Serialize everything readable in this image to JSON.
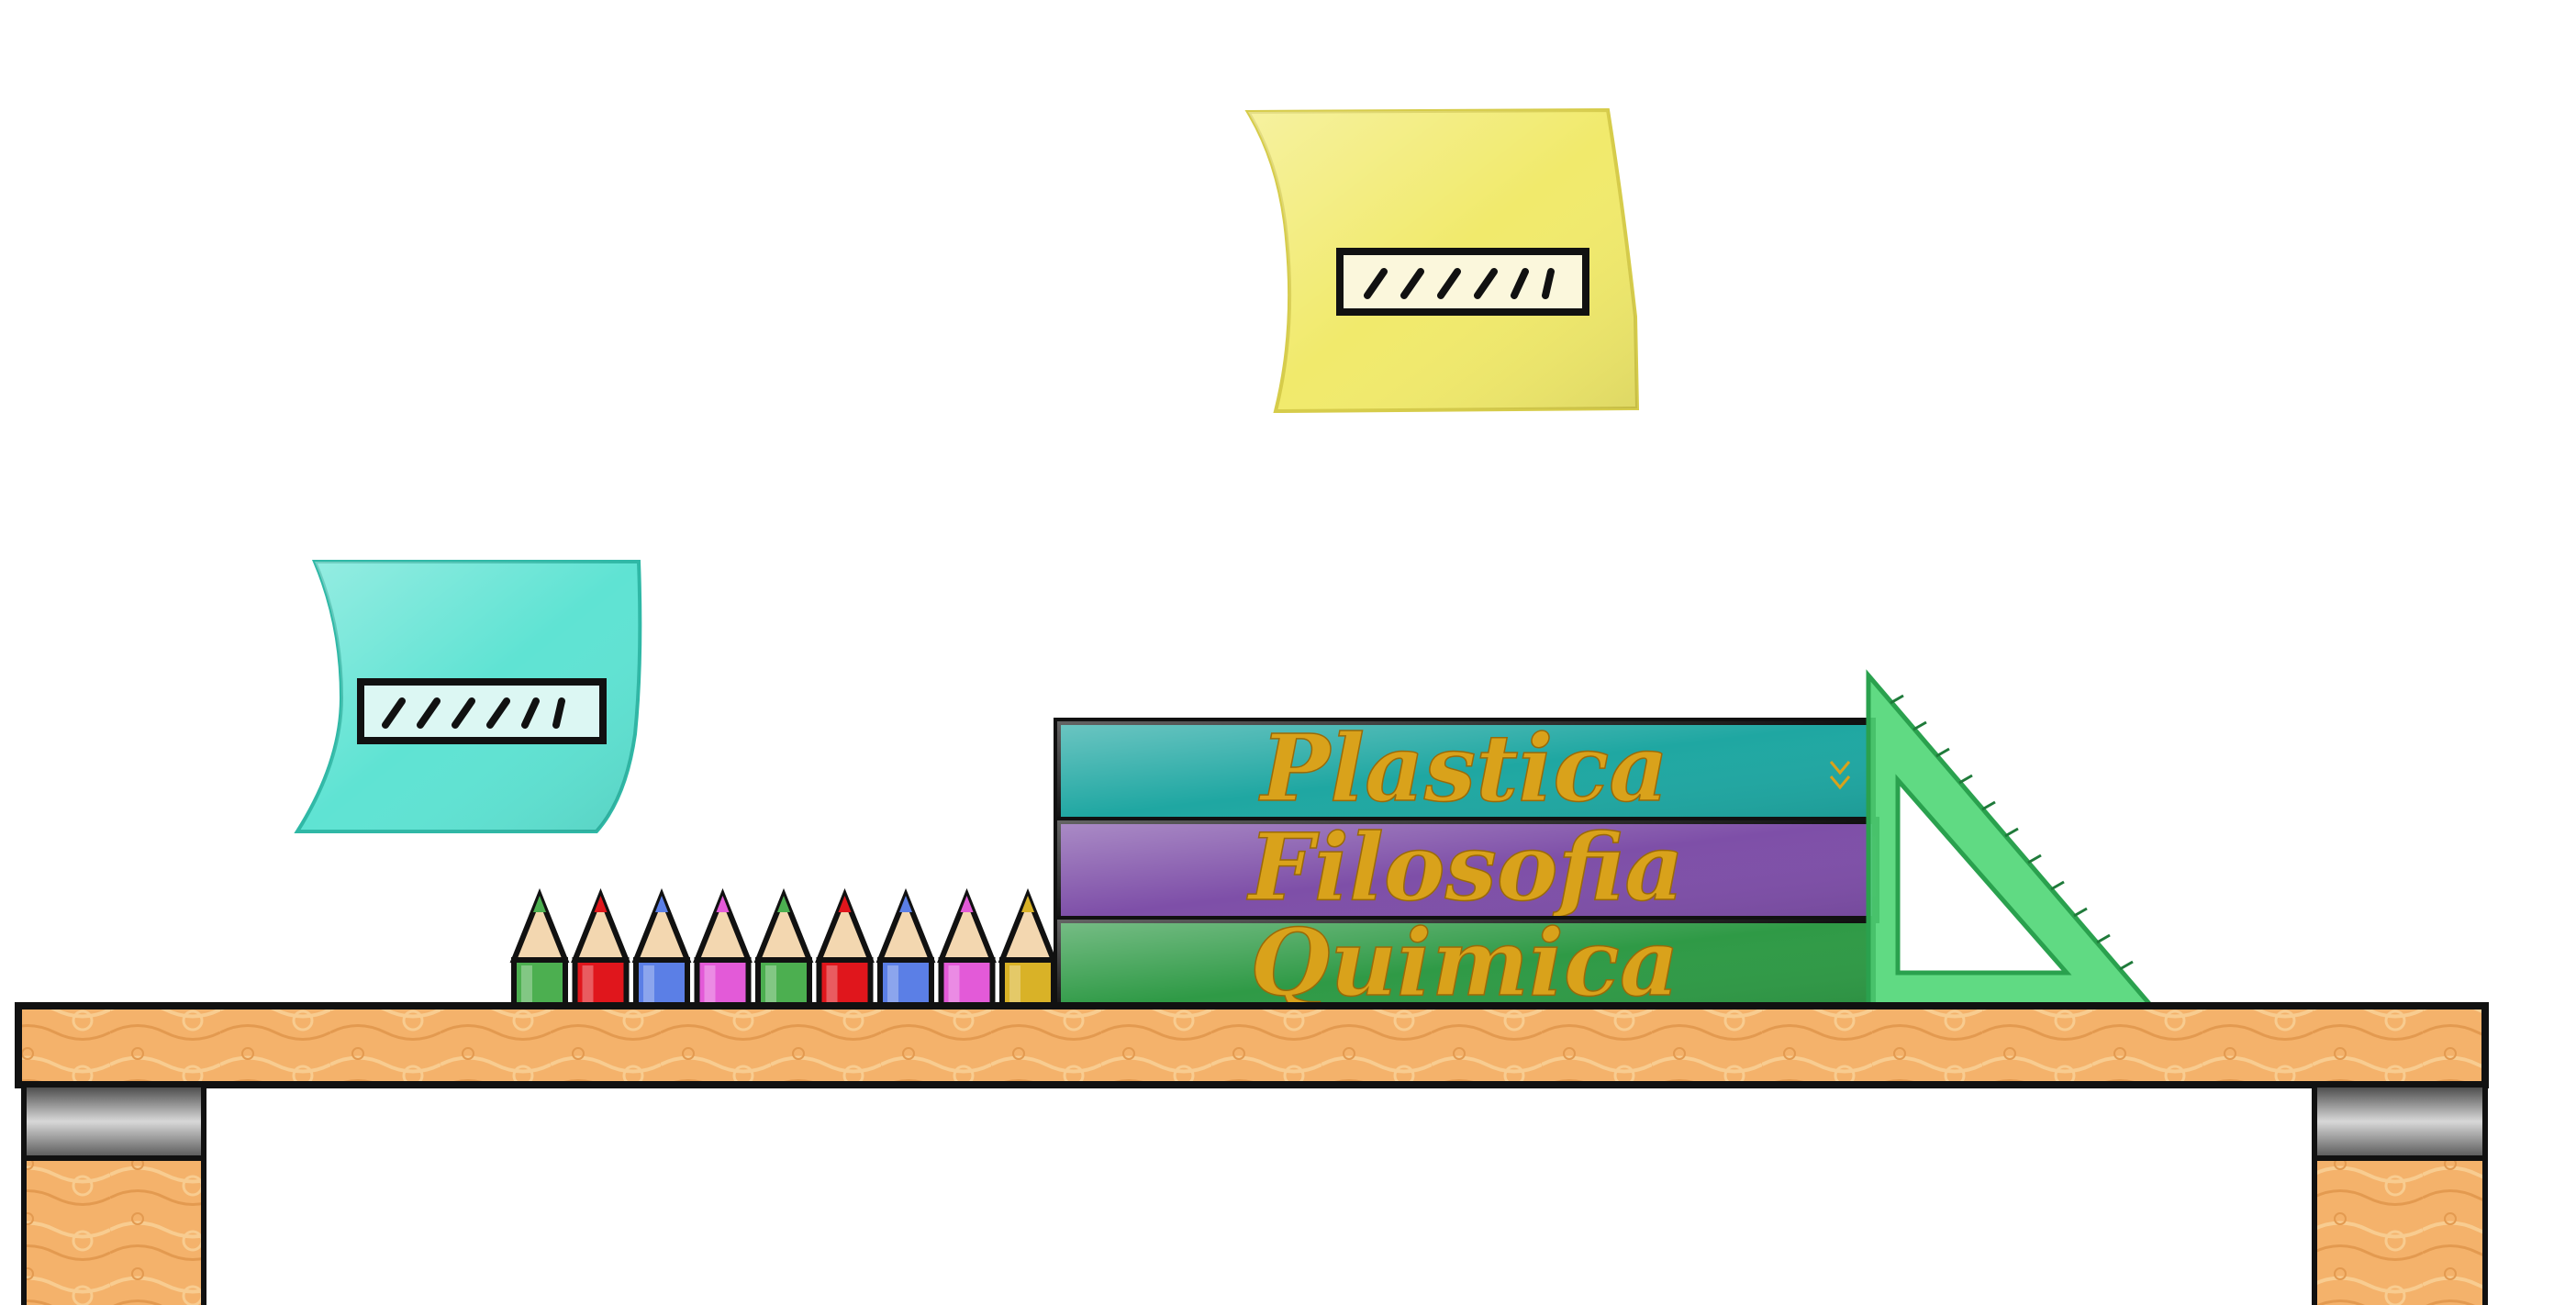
{
  "scene": {
    "books": [
      {
        "title": "Plastica",
        "color": "#1fa7a2"
      },
      {
        "title": "Filosofia",
        "color": "#7e4fa8"
      },
      {
        "title": "Quimica",
        "color": "#2f9a46"
      }
    ],
    "notes": [
      {
        "name": "yellow-sticky-note",
        "color": "#f1ea6c"
      },
      {
        "name": "teal-sticky-note",
        "color": "#5fe3d3"
      }
    ],
    "pencil_colors": [
      "#4caf50",
      "#e0161c",
      "#5b7fe6",
      "#e35ad8",
      "#4caf50",
      "#e0161c",
      "#5b7fe6",
      "#e35ad8",
      "#d9b227"
    ],
    "desk_color": "#f4b26b",
    "triangle_color": "#4fd676",
    "title_color": "#d9a21b"
  }
}
